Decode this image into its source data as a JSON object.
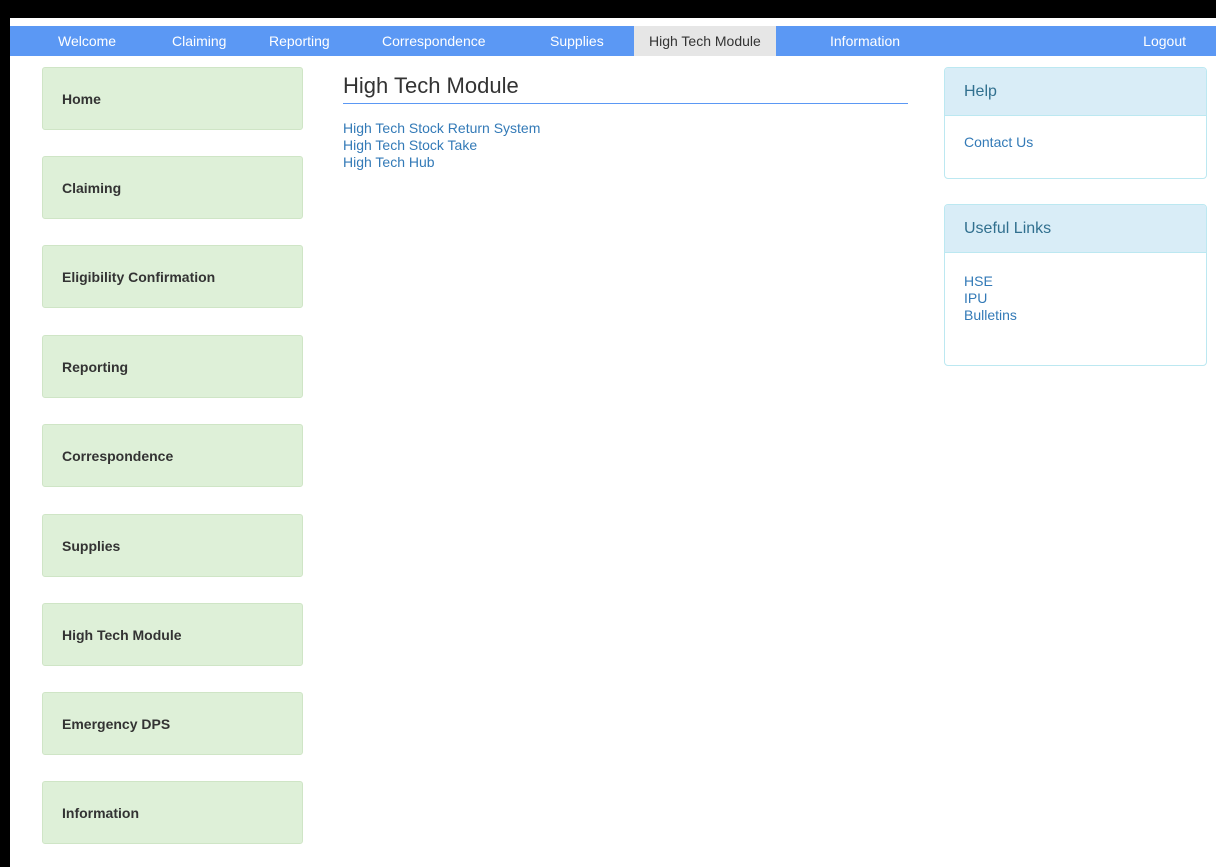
{
  "topnav": {
    "items": [
      {
        "label": "Welcome",
        "active": false
      },
      {
        "label": "Claiming",
        "active": false
      },
      {
        "label": "Reporting",
        "active": false
      },
      {
        "label": "Correspondence",
        "active": false
      },
      {
        "label": "Supplies",
        "active": false
      },
      {
        "label": "High Tech Module",
        "active": true
      },
      {
        "label": "Information",
        "active": false
      }
    ],
    "logout_label": "Logout"
  },
  "sidebar": {
    "items": [
      {
        "label": "Home"
      },
      {
        "label": "Claiming"
      },
      {
        "label": "Eligibility Confirmation"
      },
      {
        "label": "Reporting"
      },
      {
        "label": "Correspondence"
      },
      {
        "label": "Supplies"
      },
      {
        "label": "High Tech Module"
      },
      {
        "label": "Emergency DPS"
      },
      {
        "label": "Information"
      }
    ]
  },
  "main": {
    "title": "High Tech Module",
    "links": [
      {
        "label": "High Tech Stock Return System"
      },
      {
        "label": "High Tech Stock Take"
      },
      {
        "label": "High Tech Hub"
      }
    ]
  },
  "help_panel": {
    "heading": "Help",
    "links": [
      {
        "label": "Contact Us"
      }
    ]
  },
  "useful_links_panel": {
    "heading": "Useful Links",
    "links": [
      {
        "label": "HSE"
      },
      {
        "label": "IPU"
      },
      {
        "label": "Bulletins"
      }
    ]
  },
  "colors": {
    "nav_bar": "#5b98f4",
    "nav_active": "#e6e6e6",
    "sidebar_button": "#def0d8",
    "link": "#337ab7",
    "panel_heading": "#d9edf7"
  }
}
